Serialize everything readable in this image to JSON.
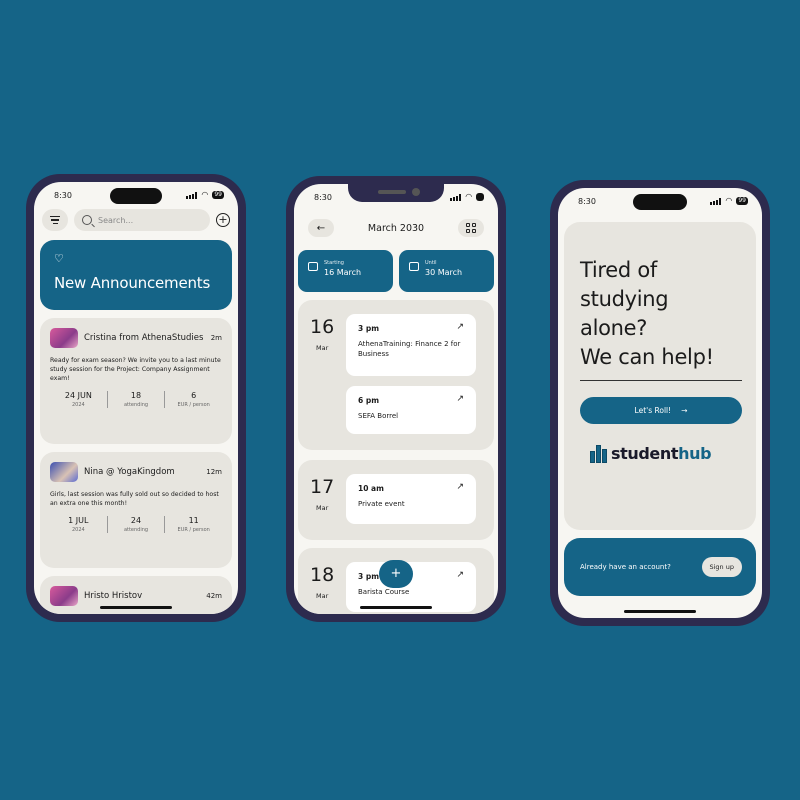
{
  "phone1": {
    "status": {
      "time": "8:30",
      "wifi_icon": "wifi-icon",
      "battery": "99"
    },
    "search": {
      "placeholder": "Search..."
    },
    "banner": {
      "icon": "heart-icon",
      "title": "New Announcements"
    },
    "announcements": [
      {
        "author": "Cristina from AthenaStudies",
        "time": "2m",
        "body": "Ready for exam season? We invite you to a last minute study session for the Project: Company Assignment exam!",
        "date": "24 JUN",
        "date_sub": "2024",
        "attending": "18",
        "attending_sub": "attending",
        "price": "6",
        "price_sub": "EUR / person"
      },
      {
        "author": "Nina @ YogaKingdom",
        "time": "12m",
        "body": "Girls, last session was fully sold out so decided to host an extra one this month!",
        "date": "1 JUL",
        "date_sub": "2024",
        "attending": "24",
        "attending_sub": "attending",
        "price": "11",
        "price_sub": "EUR / person"
      },
      {
        "author": "Hristo Hristov",
        "time": "42m"
      }
    ]
  },
  "phone2": {
    "status": {
      "time": "8:30"
    },
    "title": "March 2030",
    "starting": {
      "label": "Starting",
      "value": "16 March"
    },
    "until": {
      "label": "Until",
      "value": "30 March"
    },
    "days": [
      {
        "num": "16",
        "mon": "Mar",
        "events": [
          {
            "time": "3 pm",
            "name": "AthenaTraining: Finance 2 for Business"
          },
          {
            "time": "6 pm",
            "name": "SEFA Borrel"
          }
        ]
      },
      {
        "num": "17",
        "mon": "Mar",
        "events": [
          {
            "time": "10 am",
            "name": "Private event"
          }
        ]
      },
      {
        "num": "18",
        "mon": "Mar",
        "events": [
          {
            "time": "3 pm",
            "name": "Barista Course"
          }
        ]
      }
    ],
    "fab": "+"
  },
  "phone3": {
    "status": {
      "time": "8:30",
      "battery": "99"
    },
    "headline": [
      "Tired of",
      "studying",
      "alone?",
      "We can help!"
    ],
    "cta": "Let's Roll!",
    "logo": {
      "part1": "student",
      "part2": "hub"
    },
    "account_question": "Already have an account?",
    "signup": "Sign up"
  },
  "colors": {
    "brand": "#156487",
    "frame": "#2d2b4e",
    "card": "#e7e5df",
    "screen": "#f7f6f2"
  }
}
